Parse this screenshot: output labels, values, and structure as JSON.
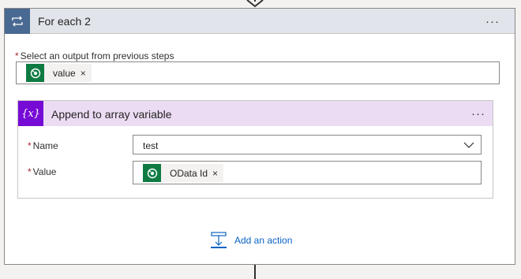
{
  "foreach": {
    "title": "For each 2",
    "menu": "···",
    "select_label": "Select an output from previous steps",
    "required_mark": "*",
    "token": {
      "label": "value",
      "remove": "×"
    }
  },
  "append": {
    "title": "Append to array variable",
    "icon_text": "{x}",
    "menu": "···",
    "name_label": "Name",
    "name_value": "test",
    "value_label": "Value",
    "value_token": {
      "label": "OData Id",
      "remove": "×"
    },
    "required_mark": "*"
  },
  "add_action": {
    "label": "Add an action"
  },
  "colors": {
    "foreach_header": "#e1e4ea",
    "foreach_icon": "#486991",
    "append_header": "#ebdcf4",
    "append_icon": "#770bd6",
    "dataverse_icon": "#0f7b43",
    "link": "#0b63c4",
    "required": "#a4262c"
  }
}
